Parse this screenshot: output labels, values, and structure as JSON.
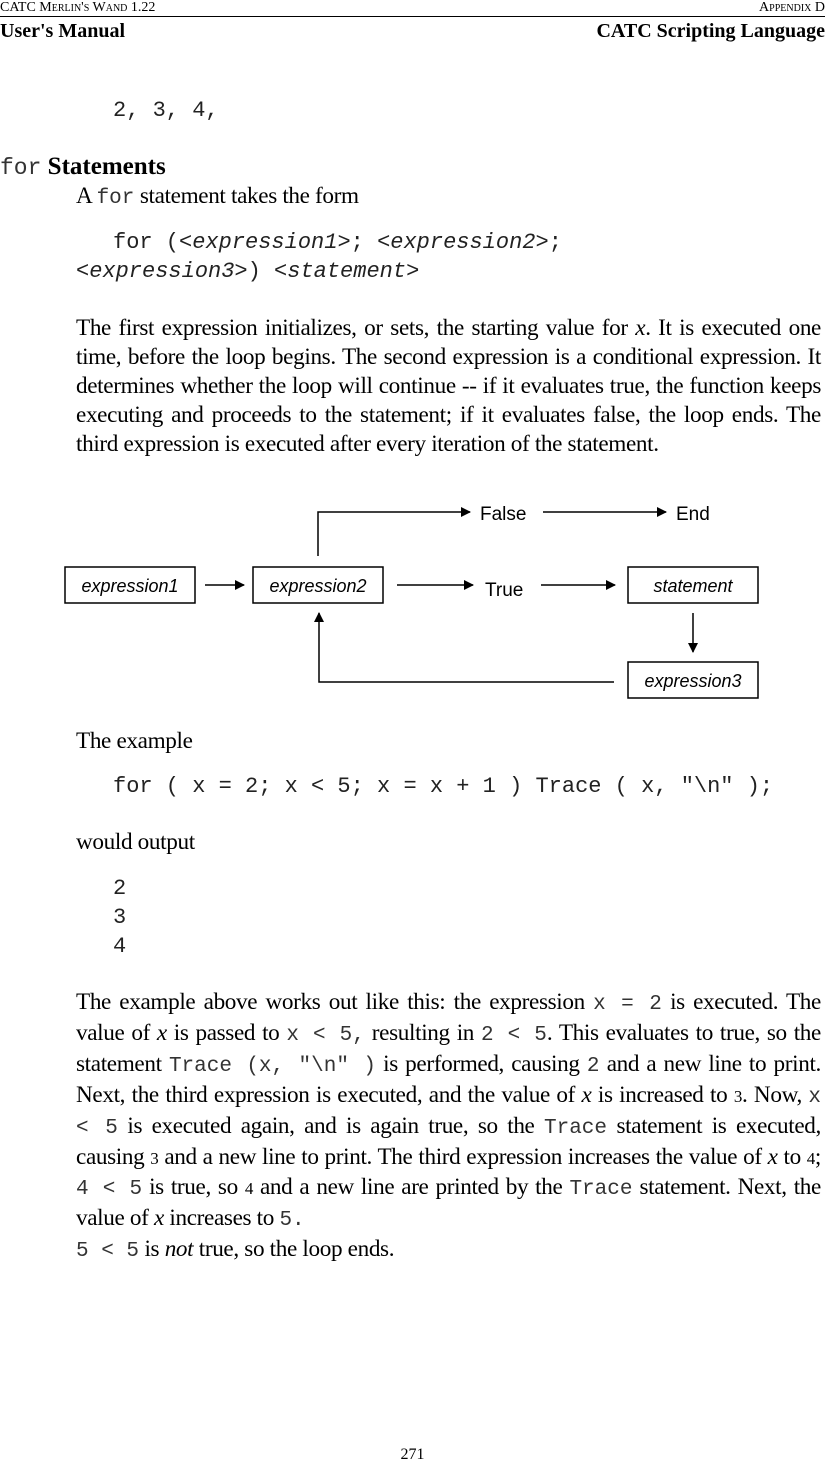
{
  "header": {
    "left_top": "CATC Merlin's Wand 1.22",
    "right_top": "Appendix D",
    "left_bottom": "User's Manual",
    "right_bottom": "CATC Scripting Language"
  },
  "top_code": "2, 3, 4,",
  "section": {
    "heading_code": "for",
    "heading_text": "Statements",
    "intro_pre": "A ",
    "intro_code": "for",
    "intro_post": " statement takes the form",
    "syntax_line1": "for (<expression1>; <expression2>;",
    "syntax_line2": "<expression3>) <statement>",
    "description": [
      "The first expression initializes, or sets, the starting value for ",
      "x",
      ". It is executed one time, before the loop begins. The second expression is a conditional expression. It determines whether the loop will continue -- if it evaluates true, the function keeps executing and proceeds to the statement; if it evaluates false, the loop ends. The third expression is executed after every iteration of the statement."
    ]
  },
  "diagram": {
    "nodes": {
      "expression1": "expression1",
      "expression2": "expression2",
      "statement": "statement",
      "expression3": "expression3"
    },
    "labels": {
      "false": "False",
      "end": "End",
      "true": "True"
    },
    "edges": [
      {
        "from": "expression1",
        "to": "expression2"
      },
      {
        "from": "expression2",
        "to": "False"
      },
      {
        "from": "False",
        "to": "End"
      },
      {
        "from": "expression2",
        "to": "True"
      },
      {
        "from": "True",
        "to": "statement"
      },
      {
        "from": "statement",
        "to": "expression3"
      },
      {
        "from": "expression3",
        "to": "expression2"
      }
    ]
  },
  "example": {
    "intro": "The example",
    "code": "for ( x = 2; x < 5; x = x + 1 ) Trace ( x, \"\\n\" );",
    "output_intro": "would output",
    "output_lines": [
      "2",
      "3",
      "4"
    ]
  },
  "explanation": {
    "s1": "The example above works out like this: the expression ",
    "c1": "x = 2",
    "s2": " is executed. The value of ",
    "i1": "x",
    "s3": " is passed to ",
    "c2": "x < 5,",
    "s4": " resulting in ",
    "c3": "2 < 5",
    "s5": ". This evaluates to true, so the statement ",
    "c4": "Trace (x, \"\\n\" )",
    "s6": " is performed, causing ",
    "c5": "2",
    "s7": "  and a new line to print. Next, the third expression is executed, and the value of ",
    "i2": "x",
    "s8": " is increased to ",
    "n1": "3",
    "s9": ". Now, ",
    "c6": "x < 5",
    "s10": " is executed again, and is again true, so the ",
    "c7": "Trace",
    "s11": " statement is executed, causing ",
    "n2": "3",
    "s12": " and a new line to print. The third expression increases the value of ",
    "i3": "x",
    "s13": " to ",
    "n3": "4",
    "s14": "; ",
    "c8": "4 < 5",
    "s15": " is true, so ",
    "n4": "4",
    "s16": " and a new line are printed by the ",
    "c9": "Trace",
    "s17": " statement. Next, the value of ",
    "i4": "x",
    "s18": " increases to ",
    "c10": "5.",
    "c11": "5 < 5",
    "s19": " is ",
    "i5": "not",
    "s20": " true, so the loop ends."
  },
  "footer": {
    "page_number": "271"
  }
}
